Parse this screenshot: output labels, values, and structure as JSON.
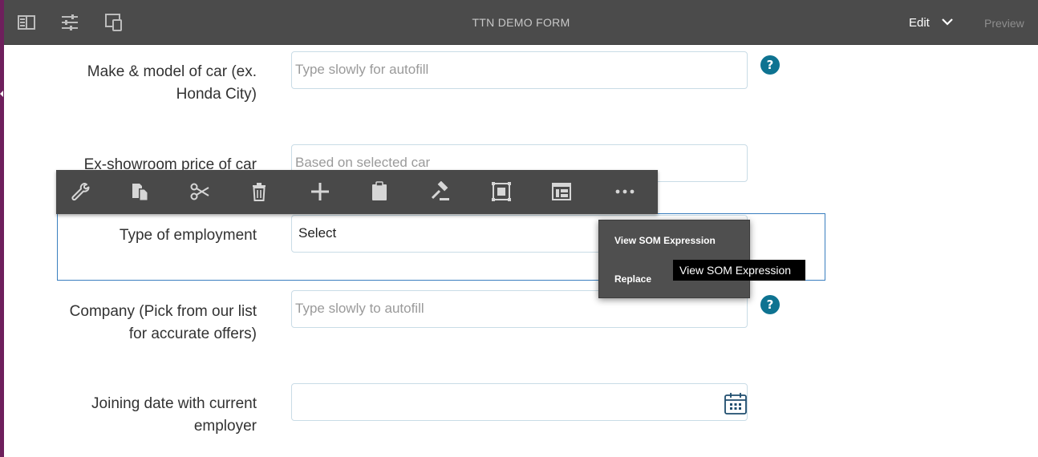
{
  "header": {
    "title": "TTN DEMO FORM",
    "mode": "Edit",
    "preview": "Preview",
    "icons": [
      "side-panel-icon",
      "properties-icon",
      "emulator-icon"
    ]
  },
  "form": {
    "car_model": {
      "label": "Make & model of car (ex. Honda City)",
      "placeholder": "Type slowly for autofill"
    },
    "price": {
      "label": "Ex-showroom price of car",
      "placeholder": "Based on selected car"
    },
    "employment": {
      "label": "Type of employment",
      "value": "Select"
    },
    "company": {
      "label": "Company (Pick from our list for accurate offers)",
      "placeholder": "Type slowly to autofill"
    },
    "joining_date": {
      "label": "Joining date with current employer",
      "placeholder": ""
    },
    "help_glyph": "?"
  },
  "toolbar": {
    "icons": [
      "wrench-icon",
      "copy-icon",
      "cut-icon",
      "trash-icon",
      "plus-icon",
      "paste-icon",
      "gavel-icon",
      "group-icon",
      "panel-icon",
      "more-icon"
    ]
  },
  "menu": {
    "items": [
      "View SOM Expression",
      "Replace"
    ],
    "tooltip": "View SOM Expression"
  },
  "colors": {
    "header_bg": "#4b4b4b",
    "toolbar_bg": "#494949",
    "help_blue": "#0e7391",
    "selection": "#3a7fbf",
    "edge": "#6e1f5c"
  }
}
